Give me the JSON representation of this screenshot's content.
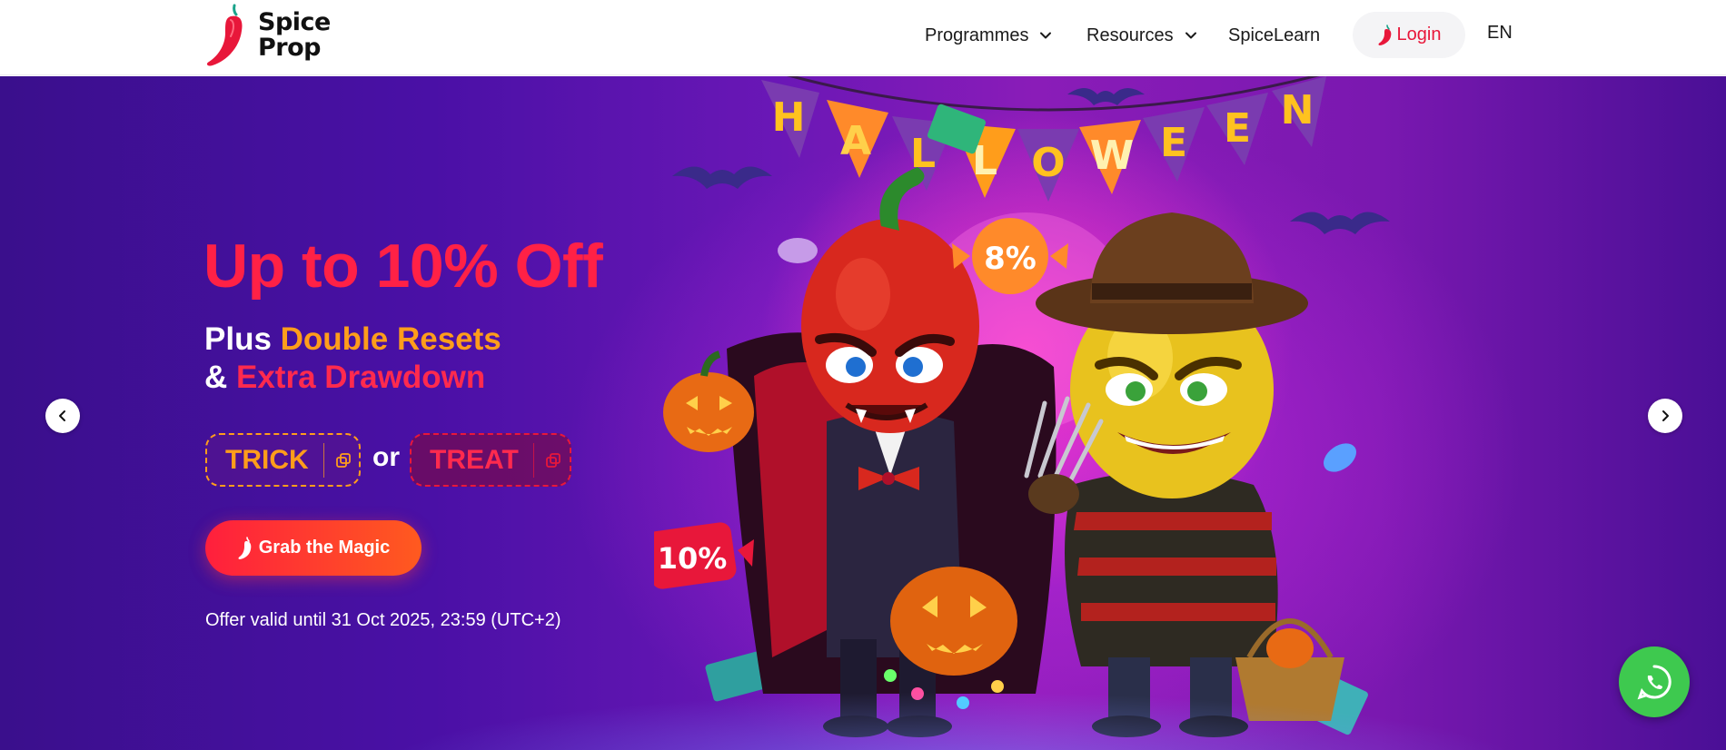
{
  "header": {
    "brand": {
      "line1": "Spice",
      "line2": "Prop"
    },
    "nav": [
      {
        "label": "Programmes",
        "has_dropdown": true
      },
      {
        "label": "Resources",
        "has_dropdown": true
      },
      {
        "label": "SpiceLearn",
        "has_dropdown": false
      }
    ],
    "login_label": "Login",
    "language": "EN"
  },
  "hero": {
    "headline": "Up to 10% Off",
    "line1_prefix": "Plus ",
    "line1_highlight": "Double Resets",
    "line2_prefix": "& ",
    "line2_highlight": "Extra Drawdown",
    "codes": [
      {
        "label": "TRICK",
        "icon": "copy-icon"
      },
      {
        "label": "TREAT",
        "icon": "copy-icon"
      }
    ],
    "or_text": "or",
    "cta_label": "Grab the Magic",
    "validity": "Offer valid until 31 Oct 2025, 23:59 (UTC+2)",
    "banner_letters": [
      "H",
      "A",
      "L",
      "L",
      "O",
      "W",
      "E",
      "E",
      "N"
    ],
    "badge_top": "8%",
    "badge_left": "10%"
  },
  "icons": {
    "carousel_prev": "chevron-left-icon",
    "carousel_next": "chevron-right-icon",
    "chat": "whatsapp-icon"
  },
  "colors": {
    "brand_red": "#e8173a",
    "accent_orange": "#ff9d1b",
    "whatsapp_green": "#3ec94f",
    "hero_purple": "#4a10a6"
  }
}
